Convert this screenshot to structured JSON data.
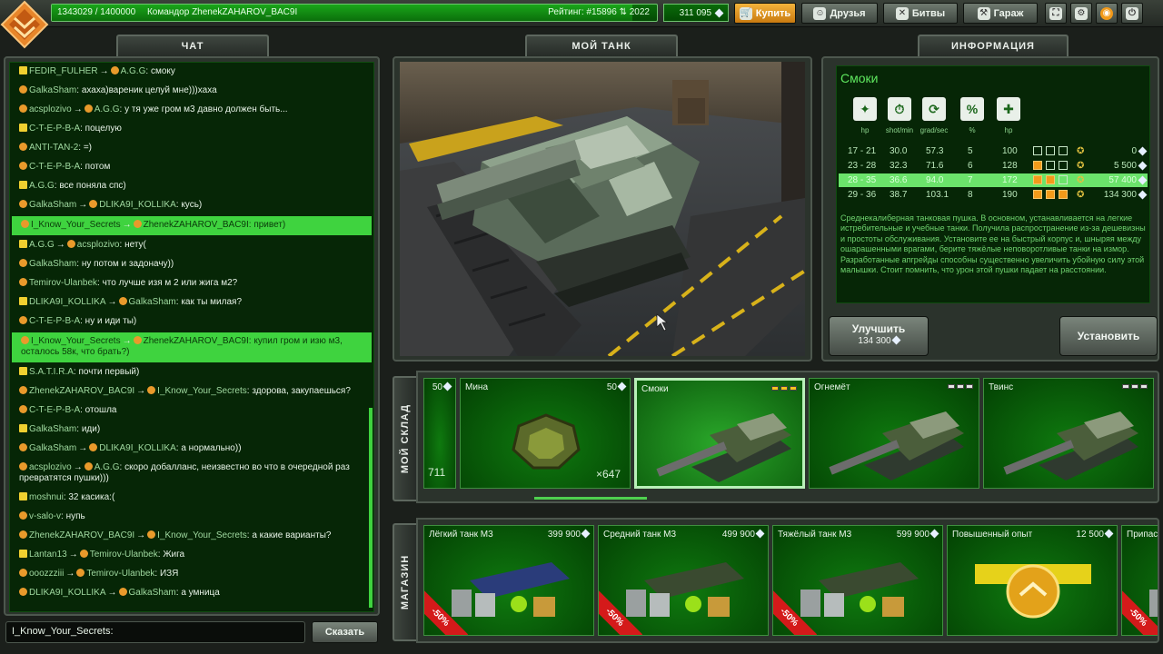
{
  "top": {
    "experience": "1343029 / 1400000",
    "experience_progress": 0.959,
    "player": "Командор ZhenekZAHAROV_BAC9I",
    "rating": "Рейтинг: #15896",
    "rating_delta": "2022",
    "crystals": "311 095",
    "buy_label": "Купить",
    "friends_label": "Друзья",
    "battles_label": "Битвы",
    "garage_label": "Гараж"
  },
  "sections": {
    "chat": "ЧАТ",
    "my_tank": "МОЙ ТАНК",
    "info": "ИНФОРМАЦИЯ",
    "warehouse": "МОЙ СКЛАД",
    "shop": "МАГАЗИН"
  },
  "chat": {
    "messages": [
      {
        "from": "FEDIR_FULHER",
        "to": "A.G.G",
        "text": "смоку",
        "highlight": false
      },
      {
        "from": "GalkaSham",
        "to": "",
        "text": "ахаха)вареник целуй мне)))хаха",
        "highlight": false
      },
      {
        "from": "acsplozivo",
        "to": "A.G.G",
        "text": "у тя уже гром м3 давно должен быть...",
        "highlight": false
      },
      {
        "from": "C-T-E-P-B-A",
        "to": "",
        "text": "поцелую",
        "highlight": false
      },
      {
        "from": "ANTI-TAN-2",
        "to": "",
        "text": "=)",
        "highlight": false
      },
      {
        "from": "C-T-E-P-B-A",
        "to": "",
        "text": "потом",
        "highlight": false
      },
      {
        "from": "A.G.G",
        "to": "",
        "text": "все поняла спс)",
        "highlight": false
      },
      {
        "from": "GalkaSham",
        "to": "DLIKA9I_KOLLIKA",
        "text": "кусь)",
        "highlight": false
      },
      {
        "from": "I_Know_Your_Secrets",
        "to": "ZhenekZAHAROV_BAC9I",
        "text": "привет)",
        "highlight": true
      },
      {
        "from": "A.G.G",
        "to": "acsplozivo",
        "text": "нету(",
        "highlight": false
      },
      {
        "from": "GalkaSham",
        "to": "",
        "text": "ну потом и задоначу))",
        "highlight": false
      },
      {
        "from": "Temirov-Ulanbek",
        "to": "",
        "text": "что лучше изя м 2 или жига м2?",
        "highlight": false
      },
      {
        "from": "DLIKA9I_KOLLIKA",
        "to": "GalkaSham",
        "text": "как ты милая?",
        "highlight": false
      },
      {
        "from": "C-T-E-P-B-A",
        "to": "",
        "text": "ну и иди ты)",
        "highlight": false
      },
      {
        "from": "I_Know_Your_Secrets",
        "to": "ZhenekZAHAROV_BAC9I",
        "text": "купил гром и изю м3, осталось 58к, что брать?)",
        "highlight": true,
        "multiline": true
      },
      {
        "from": "S.A.T.I.R.A",
        "to": "",
        "text": "почти первый)",
        "highlight": false
      },
      {
        "from": "ZhenekZAHAROV_BAC9I",
        "to": "I_Know_Your_Secrets",
        "text": "здорова, закупаешься?",
        "highlight": false,
        "multiline": true
      },
      {
        "from": "C-T-E-P-B-A",
        "to": "",
        "text": "отошла",
        "highlight": false
      },
      {
        "from": "GalkaSham",
        "to": "",
        "text": "иди)",
        "highlight": false
      },
      {
        "from": "GalkaSham",
        "to": "DLIKA9I_KOLLIKA",
        "text": "а нормально))",
        "highlight": false
      },
      {
        "from": "acsplozivo",
        "to": "A.G.G",
        "text": "скоро добалланс, неизвестно во что в очередной раз превратятся пушки)))",
        "highlight": false,
        "multiline": true
      },
      {
        "from": "moshnui",
        "to": "",
        "text": "32 касика:(",
        "highlight": false
      },
      {
        "from": "v-salo-v",
        "to": "",
        "text": "нупь",
        "highlight": false
      },
      {
        "from": "ZhenekZAHAROV_BAC9I",
        "to": "I_Know_Your_Secrets",
        "text": "а какие варианты?",
        "highlight": false,
        "multiline": true
      },
      {
        "from": "Lantan13",
        "to": "Temirov-Ulanbek",
        "text": "Жига",
        "highlight": false
      },
      {
        "from": "ooozzziii",
        "to": "Temirov-Ulanbek",
        "text": "ИЗЯ",
        "highlight": false
      },
      {
        "from": "DLIKA9I_KOLLIKA",
        "to": "GalkaSham",
        "text": "а умница",
        "highlight": false
      }
    ],
    "input_value": "I_Know_Your_Secrets:",
    "send_label": "Сказать"
  },
  "info": {
    "item_name": "Смоки",
    "param_labels": [
      "hp",
      "shot/min",
      "grad/sec",
      "%",
      "hp"
    ],
    "upgrades": [
      {
        "range": "17 - 21",
        "v1": "30.0",
        "v2": "57.3",
        "v3": "5",
        "v4": "100",
        "filled": 0,
        "price": "0",
        "current": false
      },
      {
        "range": "23 - 28",
        "v1": "32.3",
        "v2": "71.6",
        "v3": "6",
        "v4": "128",
        "filled": 1,
        "price": "5 500",
        "current": false
      },
      {
        "range": "28 - 35",
        "v1": "36.6",
        "v2": "94.0",
        "v3": "7",
        "v4": "172",
        "filled": 2,
        "price": "57 400",
        "current": true
      },
      {
        "range": "29 - 36",
        "v1": "38.7",
        "v2": "103.1",
        "v3": "8",
        "v4": "190",
        "filled": 3,
        "price": "134 300",
        "current": false
      }
    ],
    "description": "Среднекалиберная танковая пушка. В основном, устанавливается на легкие истребительные и учебные танки. Получила распространение из-за дешевизны и простоты обслуживания. Установите ее на быстрый корпус и, шныряя между ошарашенными врагами, берите тяжёлые неповоротливые танки на измор. Разработанные апгрейды способны существенно увеличить убойную силу этой малышки. Стоит помнить, что урон этой пушки падает на расстоянии.",
    "upgrade_label": "Улучшить",
    "upgrade_price": "134 300",
    "install_label": "Установить"
  },
  "warehouse": {
    "items": [
      {
        "name": "",
        "price": "50",
        "count": "711",
        "selected": false
      },
      {
        "name": "Мина",
        "price": "50",
        "count": "×647",
        "selected": false
      },
      {
        "name": "Смоки",
        "price": "",
        "count": "",
        "selected": true,
        "mod": 3
      },
      {
        "name": "Огнемёт",
        "price": "",
        "count": "",
        "selected": false,
        "mod": 0
      },
      {
        "name": "Твинс",
        "price": "",
        "count": "",
        "selected": false,
        "mod": 0
      }
    ]
  },
  "shop": {
    "items": [
      {
        "name": "Лёгкий танк M3",
        "price": "399 900",
        "sale": "-50%"
      },
      {
        "name": "Средний танк M3",
        "price": "499 900",
        "sale": "-50%"
      },
      {
        "name": "Тяжёлый танк M3",
        "price": "599 900",
        "sale": "-50%"
      },
      {
        "name": "Повышенный опыт",
        "price": "12 500",
        "sale": ""
      },
      {
        "name": "Припас",
        "price": "",
        "sale": "-50%"
      }
    ]
  }
}
